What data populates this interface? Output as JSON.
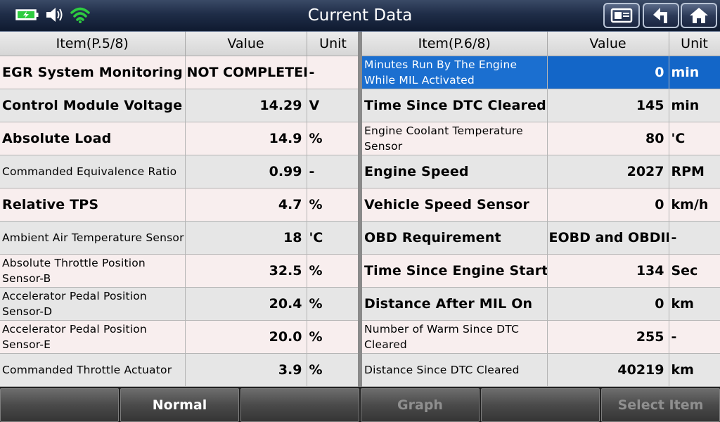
{
  "header": {
    "title": "Current Data"
  },
  "left_table": {
    "columns": [
      "Item(P.5/8)",
      "Value",
      "Unit"
    ],
    "rows": [
      {
        "item": "EGR System Monitoring",
        "value": "NOT COMPLETED",
        "unit": "-"
      },
      {
        "item": "Control Module Voltage",
        "value": "14.29",
        "unit": "V"
      },
      {
        "item": "Absolute Load",
        "value": "14.9",
        "unit": "%"
      },
      {
        "item": "Commanded Equivalence Ratio",
        "value": "0.99",
        "unit": "-"
      },
      {
        "item": "Relative TPS",
        "value": "4.7",
        "unit": "%"
      },
      {
        "item": "Ambient Air Temperature Sensor",
        "value": "18",
        "unit": "'C"
      },
      {
        "item": "Absolute Throttle Position Sensor-B",
        "value": "32.5",
        "unit": "%"
      },
      {
        "item": "Accelerator Pedal Position Sensor-D",
        "value": "20.4",
        "unit": "%"
      },
      {
        "item": "Accelerator Pedal Position Sensor-E",
        "value": "20.0",
        "unit": "%"
      },
      {
        "item": "Commanded Throttle Actuator",
        "value": "3.9",
        "unit": "%"
      }
    ]
  },
  "right_table": {
    "columns": [
      "Item(P.6/8)",
      "Value",
      "Unit"
    ],
    "rows": [
      {
        "item": "Minutes Run By The Engine While MIL Activated",
        "value": "0",
        "unit": "min"
      },
      {
        "item": "Time Since DTC Cleared",
        "value": "145",
        "unit": "min"
      },
      {
        "item": "Engine Coolant Temperature Sensor",
        "value": "80",
        "unit": "'C"
      },
      {
        "item": "Engine Speed",
        "value": "2027",
        "unit": "RPM"
      },
      {
        "item": "Vehicle Speed Sensor",
        "value": "0",
        "unit": "km/h"
      },
      {
        "item": "OBD Requirement",
        "value": "EOBD and OBDII",
        "unit": "-"
      },
      {
        "item": "Time Since Engine Start",
        "value": "134",
        "unit": "Sec"
      },
      {
        "item": "Distance After MIL On",
        "value": "0",
        "unit": "km"
      },
      {
        "item": "Number of Warm Since DTC Cleared",
        "value": "255",
        "unit": "-"
      },
      {
        "item": "Distance Since DTC Cleared",
        "value": "40219",
        "unit": "km"
      }
    ]
  },
  "toolbar": {
    "buttons": [
      "",
      "Normal",
      "",
      "Graph",
      "",
      "Select Item"
    ]
  },
  "colors": {
    "selected_row": "#1b6fd0",
    "battery": "#2ecc40",
    "wifi": "#2ecc40"
  },
  "icons": [
    "battery-icon",
    "speaker-icon",
    "wifi-icon",
    "screenshot-icon",
    "back-icon",
    "home-icon"
  ]
}
